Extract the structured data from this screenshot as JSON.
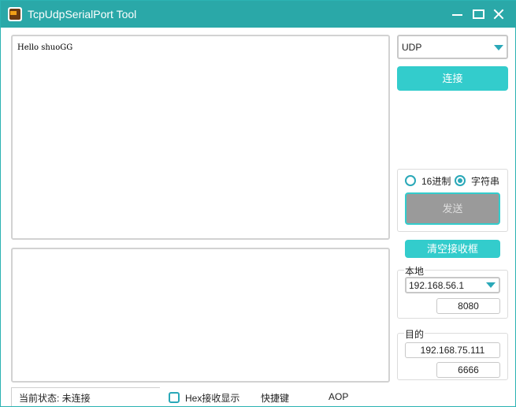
{
  "window": {
    "title": "TcpUdpSerialPort Tool"
  },
  "receive": {
    "text": "Hello shuoGG"
  },
  "send": {
    "text": ""
  },
  "protocol": {
    "selected": "UDP"
  },
  "connect_label": "连接",
  "format": {
    "hex_label": "16进制",
    "string_label": "字符串",
    "selected": "string"
  },
  "send_label": "发送",
  "clear_label": "清空接收框",
  "local": {
    "legend": "本地",
    "ip": "192.168.56.1",
    "port": "8080"
  },
  "target": {
    "legend": "目的",
    "ip": "192.168.75.111",
    "port": "6666"
  },
  "status": {
    "text": "当前状态: 未连接"
  },
  "footer": {
    "hex_display_label": "Hex接收显示",
    "shortcut_label": "快捷键",
    "aop_label": "AOP"
  },
  "colors": {
    "titlebar": "#2aa8a8",
    "accent": "#33cccc",
    "send_disabled": "#9a9a9a"
  }
}
